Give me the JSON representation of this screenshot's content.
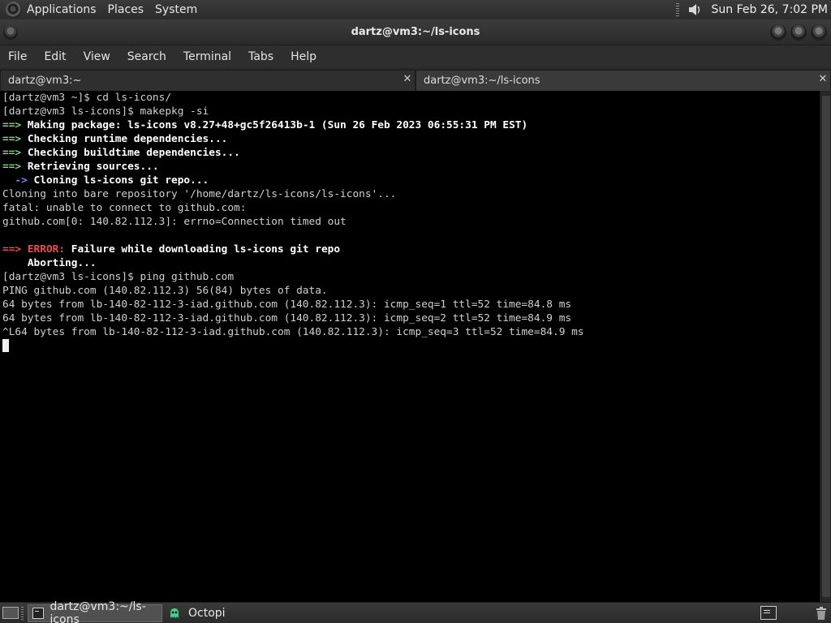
{
  "top_panel": {
    "menus": [
      "Applications",
      "Places",
      "System"
    ],
    "clock": "Sun Feb 26,  7:02 PM",
    "icons": [
      "distro-logo-icon",
      "volume-icon"
    ]
  },
  "window": {
    "title": "dartz@vm3:~/ls-icons"
  },
  "menubar": {
    "items": [
      "File",
      "Edit",
      "View",
      "Search",
      "Terminal",
      "Tabs",
      "Help"
    ]
  },
  "tabs": [
    {
      "label": "dartz@vm3:~",
      "active": false
    },
    {
      "label": "dartz@vm3:~/ls-icons",
      "active": true
    }
  ],
  "terminal": {
    "lines": [
      [
        {
          "t": "[dartz@vm3 ~]$ cd ls-icons/",
          "c": ""
        }
      ],
      [
        {
          "t": "[dartz@vm3 ls-icons]$ makepkg -si",
          "c": ""
        }
      ],
      [
        {
          "t": "==> ",
          "c": "g"
        },
        {
          "t": "Making package: ls-icons v8.27+48+gc5f26413b-1 (Sun 26 Feb 2023 06:55:31 PM EST)",
          "c": "b"
        }
      ],
      [
        {
          "t": "==> ",
          "c": "g"
        },
        {
          "t": "Checking runtime dependencies...",
          "c": "b"
        }
      ],
      [
        {
          "t": "==> ",
          "c": "g"
        },
        {
          "t": "Checking buildtime dependencies...",
          "c": "b"
        }
      ],
      [
        {
          "t": "==> ",
          "c": "g"
        },
        {
          "t": "Retrieving sources...",
          "c": "b"
        }
      ],
      [
        {
          "t": "  -> ",
          "c": "bl"
        },
        {
          "t": "Cloning ls-icons git repo...",
          "c": "b"
        }
      ],
      [
        {
          "t": "Cloning into bare repository '/home/dartz/ls-icons/ls-icons'...",
          "c": ""
        }
      ],
      [
        {
          "t": "fatal: unable to connect to github.com:",
          "c": ""
        }
      ],
      [
        {
          "t": "github.com[0: 140.82.112.3]: errno=Connection timed out",
          "c": ""
        }
      ],
      [
        {
          "t": "",
          "c": ""
        }
      ],
      [
        {
          "t": "==> ",
          "c": "r"
        },
        {
          "t": "ERROR:",
          "c": "r"
        },
        {
          "t": " Failure while downloading ls-icons git repo",
          "c": "b"
        }
      ],
      [
        {
          "t": "    Aborting...",
          "c": "b"
        }
      ],
      [
        {
          "t": "[dartz@vm3 ls-icons]$ ping github.com",
          "c": ""
        }
      ],
      [
        {
          "t": "PING github.com (140.82.112.3) 56(84) bytes of data.",
          "c": ""
        }
      ],
      [
        {
          "t": "64 bytes from lb-140-82-112-3-iad.github.com (140.82.112.3): icmp_seq=1 ttl=52 time=84.8 ms",
          "c": ""
        }
      ],
      [
        {
          "t": "64 bytes from lb-140-82-112-3-iad.github.com (140.82.112.3): icmp_seq=2 ttl=52 time=84.9 ms",
          "c": ""
        }
      ],
      [
        {
          "t": "^L64 bytes from lb-140-82-112-3-iad.github.com (140.82.112.3): icmp_seq=3 ttl=52 time=84.9 ms",
          "c": ""
        }
      ]
    ]
  },
  "taskbar": {
    "tasks": [
      {
        "label": "dartz@vm3:~/ls-icons",
        "active": true,
        "icon": "terminal-icon"
      },
      {
        "label": "Octopi",
        "active": false,
        "icon": "octopi-icon"
      }
    ],
    "icons": [
      "show-desktop-icon",
      "workspace-icon",
      "trash-icon"
    ]
  },
  "colors": {
    "green_arrow": "#7fd47f",
    "error_red": "#ef4a4a",
    "blue_arrow": "#7f88ff",
    "panel_bg": "#2e2e2e",
    "terminal_bg": "#000000"
  }
}
